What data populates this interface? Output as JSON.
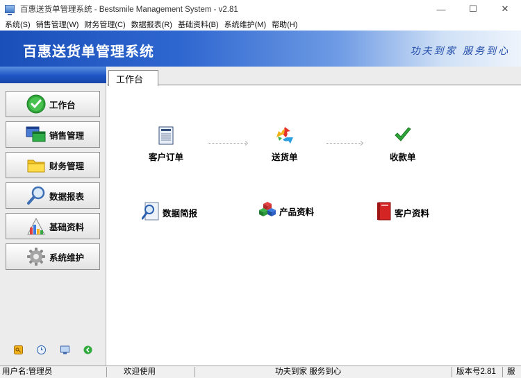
{
  "window": {
    "title": "百惠送货单管理系统 - Bestsmile Management System - v2.81",
    "controls": {
      "minimize": "—",
      "maximize": "☐",
      "close": "✕"
    }
  },
  "menu": [
    "系统(S)",
    "销售管理(W)",
    "财务管理(C)",
    "数据报表(R)",
    "基础资料(B)",
    "系统维护(M)",
    "帮助(H)"
  ],
  "banner": {
    "title": "百惠送货单管理系统",
    "slogan": "功夫到家 服务到心"
  },
  "sidebar": {
    "items": [
      {
        "label": "工作台",
        "icon": "checkmark-icon"
      },
      {
        "label": "销售管理",
        "icon": "windows-icon"
      },
      {
        "label": "财务管理",
        "icon": "folder-icon"
      },
      {
        "label": "数据报表",
        "icon": "magnifier-icon"
      },
      {
        "label": "基础资料",
        "icon": "chart-icon"
      },
      {
        "label": "系统维护",
        "icon": "gear-icon"
      }
    ],
    "bottom_icons": [
      "key-icon",
      "clock-icon",
      "monitor-icon",
      "back-icon"
    ]
  },
  "tab": {
    "label": "工作台"
  },
  "workflow": {
    "steps": [
      {
        "label": "客户订单",
        "icon": "order-document-icon"
      },
      {
        "label": "送货单",
        "icon": "recycle-arrows-icon"
      },
      {
        "label": "收款单",
        "icon": "checkmark-icon"
      }
    ],
    "links": [
      {
        "label": "数据简报",
        "icon": "magnifier-report-icon"
      },
      {
        "label": "产品资料",
        "icon": "cubes-icon"
      },
      {
        "label": "客户资料",
        "icon": "red-book-icon"
      }
    ]
  },
  "statusbar": {
    "user": "用户名:管理员",
    "welcome": "欢迎使用",
    "slogan": "功夫到家 服务到心",
    "version": "版本号2.81",
    "extra": "服"
  }
}
